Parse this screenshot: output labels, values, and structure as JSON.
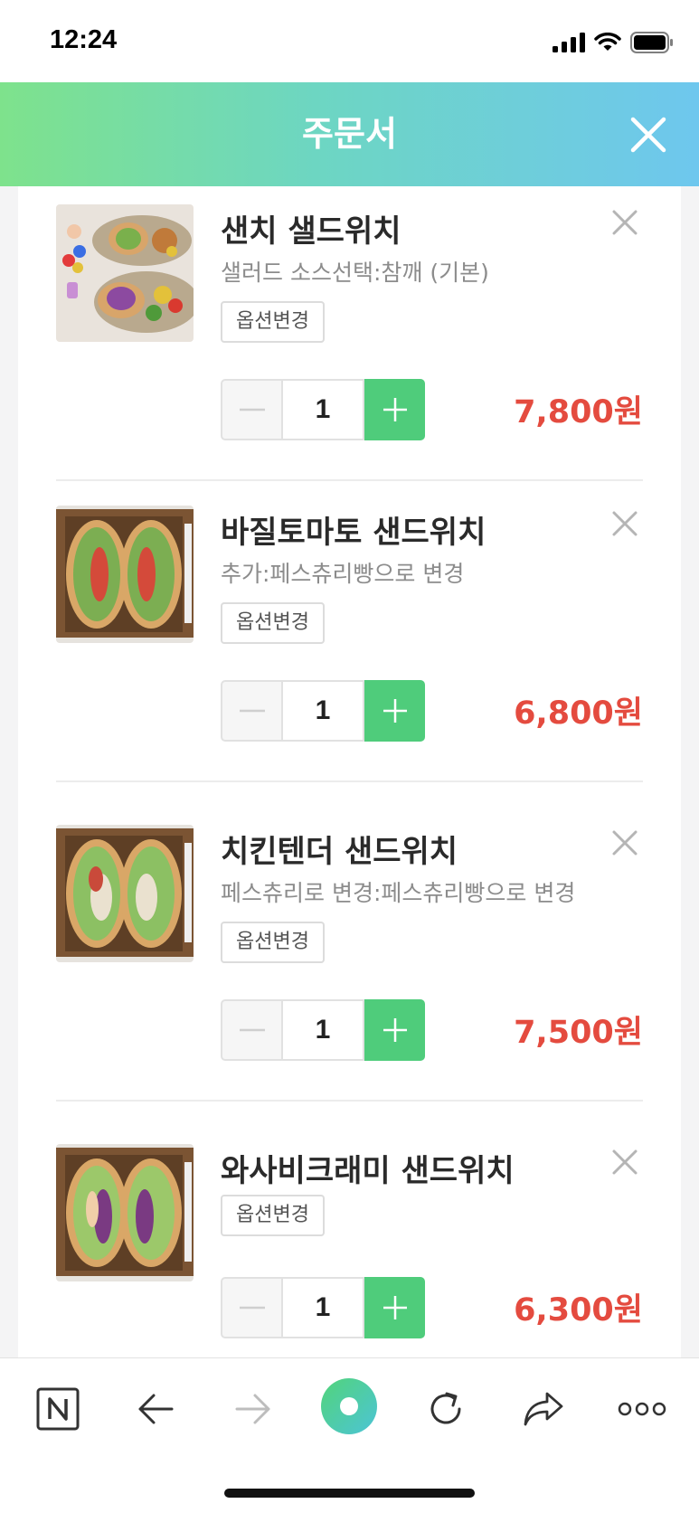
{
  "status_bar": {
    "time": "12:24"
  },
  "header": {
    "title": "주문서"
  },
  "items": [
    {
      "name": "샌치 샐드위치",
      "option": "샐러드 소스선택:참깨 (기본)",
      "option_button": "옵션변경",
      "quantity": "1",
      "price": "7,800원",
      "image": "salad-sandwich-photo"
    },
    {
      "name": "바질토마토 샌드위치",
      "option": "추가:페스츄리빵으로 변경",
      "option_button": "옵션변경",
      "quantity": "1",
      "price": "6,800원",
      "image": "sandwich-box-photo"
    },
    {
      "name": "치킨텐더 샌드위치",
      "option": "페스츄리로 변경:페스츄리빵으로 변경",
      "option_button": "옵션변경",
      "quantity": "1",
      "price": "7,500원",
      "image": "sandwich-box-photo"
    },
    {
      "name": "와사비크래미 샌드위치",
      "option": "",
      "option_button": "옵션변경",
      "quantity": "1",
      "price": "6,300원",
      "image": "sandwich-box-photo"
    }
  ],
  "toolbar": {
    "buttons": [
      "naver-home-icon",
      "back-arrow-icon",
      "forward-arrow-icon",
      "green-dot-icon",
      "refresh-icon",
      "share-icon",
      "more-icon"
    ]
  },
  "colors": {
    "accent_green": "#4fcc7b",
    "price_red": "#e44b3f",
    "header_gradient_start": "#7ee28c",
    "header_gradient_end": "#6ec7ee"
  }
}
